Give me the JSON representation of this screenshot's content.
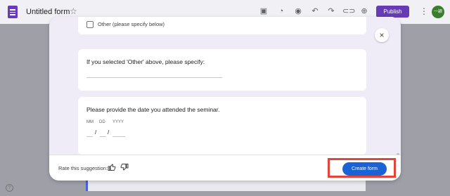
{
  "app": {
    "title": "Untitled form",
    "publish_label": "Publish",
    "avatar_text": "一颖",
    "help_symbol": "?"
  },
  "dialog": {
    "close_symbol": "×",
    "option_label": "Other (please specify below)",
    "question_other": "If you selected 'Other' above, please specify:",
    "question_date": "Please provide the date you attended the seminar.",
    "date_labels": {
      "mm": "MM",
      "dd": "DD",
      "yyyy": "YYYY"
    },
    "date_separator": "/",
    "rate_label": "Rate this suggestion:",
    "create_label": "Create form"
  },
  "colors": {
    "accent": "#673ab7",
    "create_button": "#1a63d6",
    "highlight": "#e0463c"
  },
  "icons": [
    "forms-logo-icon",
    "star-icon",
    "customize-icon",
    "palette-icon",
    "preview-icon",
    "undo-icon",
    "redo-icon",
    "link-icon",
    "add-collaborator-icon",
    "more-icon",
    "close-icon",
    "thumbs-up-icon",
    "thumbs-down-icon",
    "help-icon"
  ]
}
